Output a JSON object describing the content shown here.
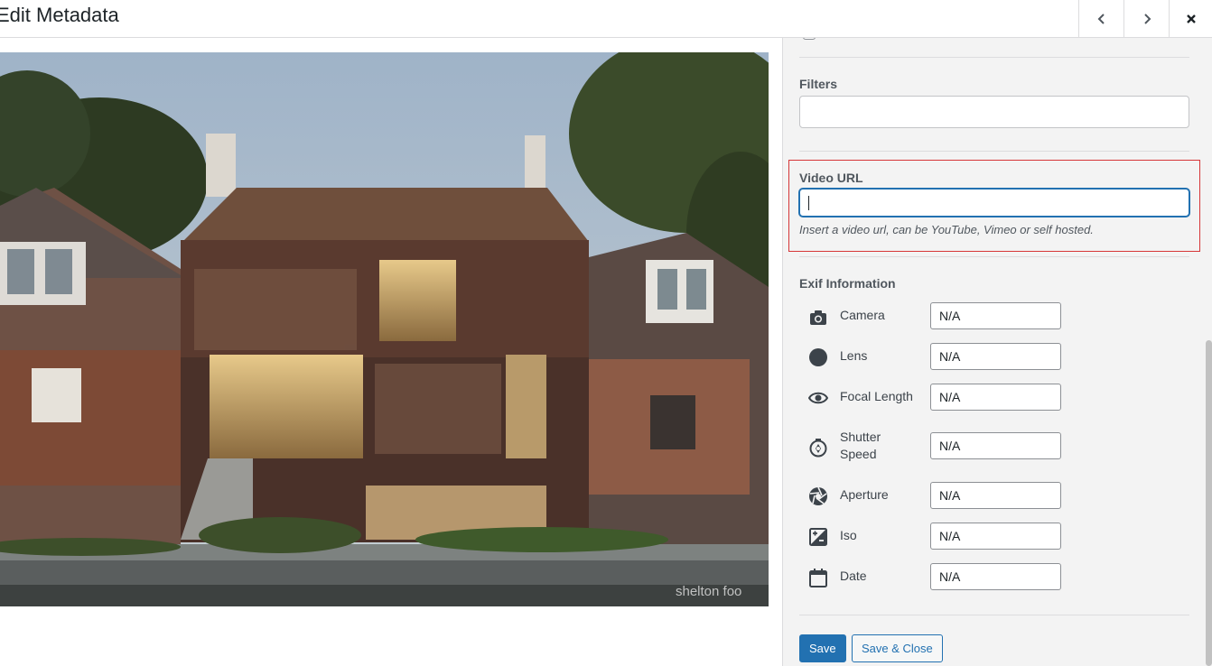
{
  "header": {
    "title": "Edit Metadata",
    "prev_icon": "chevron-left-icon",
    "next_icon": "chevron-right-icon",
    "close_icon": "close-icon"
  },
  "image": {
    "watermark": "shelton foo"
  },
  "sidebar": {
    "filters": {
      "label": "Filters",
      "value": ""
    },
    "video_url": {
      "label": "Video URL",
      "value": "",
      "help": "Insert a video url, can be YouTube, Vimeo or self hosted."
    },
    "exif": {
      "heading": "Exif Information",
      "fields": [
        {
          "label": "Camera",
          "value": "N/A",
          "icon": "camera-icon"
        },
        {
          "label": "Lens",
          "value": "N/A",
          "icon": "lens-icon"
        },
        {
          "label": "Focal Length",
          "value": "N/A",
          "icon": "eye-icon"
        },
        {
          "label": "Shutter Speed",
          "label_line1": "Shutter",
          "label_line2": "Speed",
          "value": "N/A",
          "icon": "shutter-icon"
        },
        {
          "label": "Aperture",
          "value": "N/A",
          "icon": "aperture-icon"
        },
        {
          "label": "Iso",
          "value": "N/A",
          "icon": "iso-icon"
        },
        {
          "label": "Date",
          "value": "N/A",
          "icon": "calendar-icon"
        }
      ]
    },
    "buttons": {
      "save": "Save",
      "save_close": "Save & Close"
    }
  },
  "colors": {
    "accent": "#2271b1",
    "highlight": "#d63638",
    "sidebar_bg": "#f3f3f3"
  }
}
